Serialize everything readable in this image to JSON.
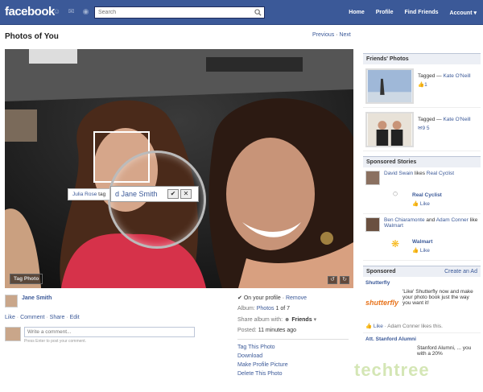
{
  "topbar": {
    "logo": "facebook",
    "search_placeholder": "Search",
    "nav": [
      "Home",
      "Profile",
      "Find Friends",
      "Account ▾"
    ]
  },
  "page": {
    "title": "Photos of You",
    "previous": "Previous",
    "dot": " · ",
    "next": "Next"
  },
  "photo": {
    "tag_photo_button": "Tag Photo",
    "tagger_text": "Julia Rose",
    "tagger_suffix": " tag",
    "tag_input_value": "d Jane Smith"
  },
  "owner": {
    "name": "Jane Smith",
    "actions": [
      "Like",
      "Comment",
      "Share",
      "Edit"
    ],
    "comment_placeholder": "Write a comment...",
    "comment_hint": "Press Enter to post your comment."
  },
  "meta": {
    "on_profile": "On your profile",
    "remove": "Remove",
    "album_label": "Album:",
    "album_name": "Photos",
    "album_pos": "1 of 7",
    "share_label": "Share album with:",
    "share_value": "Friends",
    "posted_label": "Posted:",
    "posted_value": "11 minutes ago",
    "links": [
      "Tag This Photo",
      "Download",
      "Make Profile Picture",
      "Delete This Photo"
    ]
  },
  "sidebar": {
    "friends_photos_title": "Friends' Photos",
    "photos": [
      {
        "tagged": "Tagged —",
        "who": "Kate O'Neill",
        "counts": "1"
      },
      {
        "tagged": "Tagged —",
        "who": "Kate O'Neill",
        "counts": "9  5"
      }
    ],
    "sponsored_stories_title": "Sponsored Stories",
    "stories": [
      {
        "actor": "David Swain",
        "verb": " likes ",
        "page": "Real Cyclist",
        "page_name": "Real Cyclist",
        "like": "Like"
      },
      {
        "actor": "Ben Chiaramonte",
        "verb": " and ",
        "actor2": "Adam Conner",
        "verb2": " like ",
        "page": "Walmart",
        "page_name": "Walmart",
        "like": "Like"
      }
    ],
    "sponsored_title": "Sponsored",
    "create_ad": "Create an Ad",
    "ad": {
      "title": "Shutterfly",
      "logo": "shutterfly",
      "body": "'Like' Shutterfly now and make your photo book just the way you want it!",
      "like": "Like",
      "like_by": " · Adam Conner likes this."
    },
    "ad2": {
      "title": "Att. Stanford Alumni",
      "body": "Stanford Alumni, ... you with a 20%"
    }
  },
  "watermark": "techtree",
  "colors": {
    "brand": "#3b5998",
    "link": "#3b5998"
  }
}
